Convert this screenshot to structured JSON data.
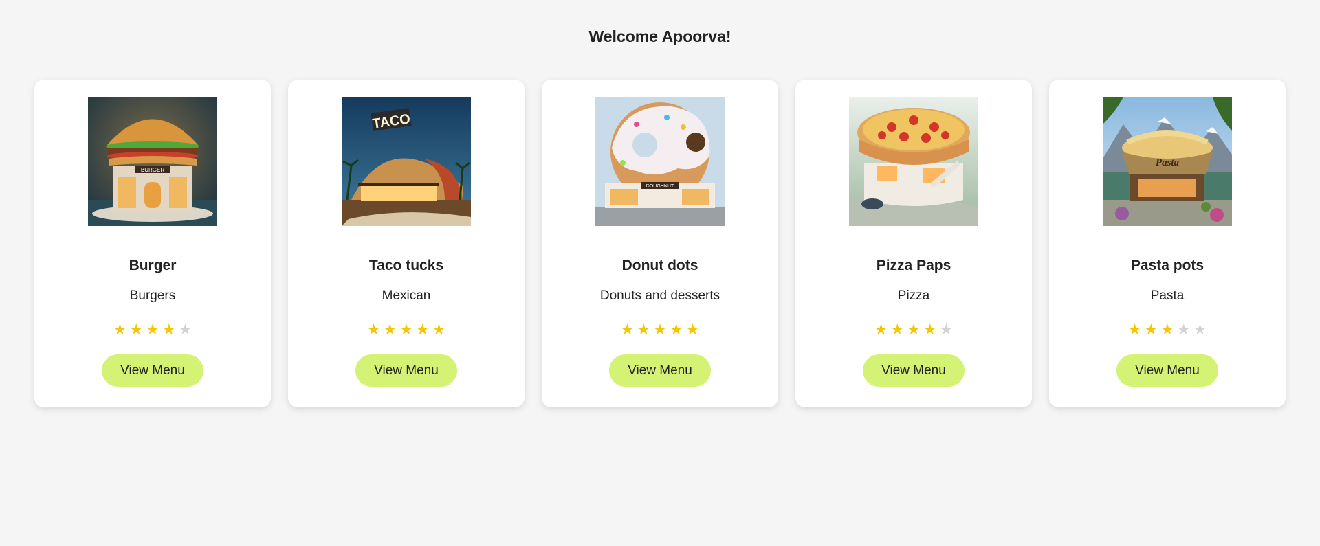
{
  "header": {
    "welcome": "Welcome Apoorva!"
  },
  "colors": {
    "star_on": "#f7c600",
    "star_off": "#d3d3d3",
    "button": "#d4f374",
    "background": "#f5f5f5"
  },
  "restaurants": [
    {
      "name": "Burger",
      "cuisine": "Burgers",
      "rating": 4,
      "max_rating": 5,
      "button": "View Menu",
      "image": "burger-building-image",
      "sign": "BURGER"
    },
    {
      "name": "Taco tucks",
      "cuisine": "Mexican",
      "rating": 5,
      "max_rating": 5,
      "button": "View Menu",
      "image": "taco-building-image",
      "sign": "TACO"
    },
    {
      "name": "Donut dots",
      "cuisine": "Donuts and desserts",
      "rating": 5,
      "max_rating": 5,
      "button": "View Menu",
      "image": "donut-building-image",
      "sign": "DOUGHNUT"
    },
    {
      "name": "Pizza Paps",
      "cuisine": "Pizza",
      "rating": 4,
      "max_rating": 5,
      "button": "View Menu",
      "image": "pizza-building-image",
      "sign": ""
    },
    {
      "name": "Pasta pots",
      "cuisine": "Pasta",
      "rating": 3,
      "max_rating": 5,
      "button": "View Menu",
      "image": "pasta-building-image",
      "sign": "Pasta"
    }
  ]
}
